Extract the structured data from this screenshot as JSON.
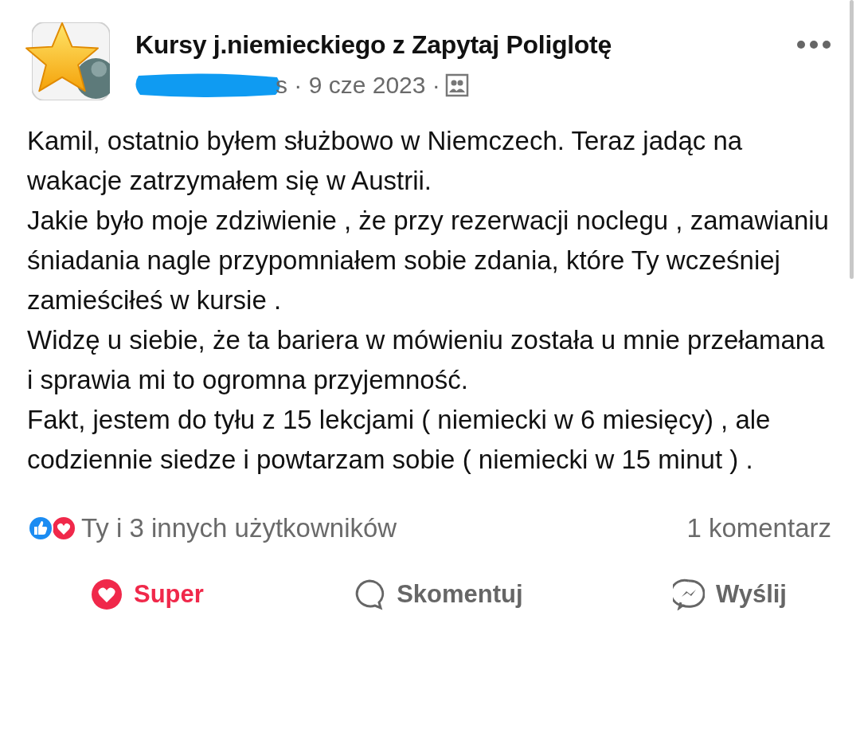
{
  "post": {
    "author": "Kursy j.niemieckiego z Zapytaj Poliglotę",
    "meta": "s · 9 cze 2023 ·",
    "paragraphs": [
      "Kamil,  ostatnio byłem służbowo w Niemczech. Teraz jadąc na wakacje zatrzymałem się w Austrii.",
      "Jakie było moje zdziwienie , że przy rezerwacji noclegu , zamawianiu śniadania nagle przypomniałem sobie zdania, które Ty wcześniej zamieściłeś w kursie .",
      "Widzę u siebie, że ta bariera w mówieniu została u mnie przełamana i sprawia mi to ogromna przyjemność.",
      "Fakt, jestem do tyłu z 15 lekcjami ( niemiecki w 6 miesięcy) , ale codziennie siedze i powtarzam sobie ( niemiecki w 15 minut ) ."
    ],
    "reactions_summary": "Ty i 3 innych użytkowników",
    "comments_count": "1 komentarz"
  },
  "actions": [
    {
      "kind": "reaction",
      "label": "Super",
      "active": true
    },
    {
      "kind": "comment",
      "label": "Skomentuj",
      "active": false
    },
    {
      "kind": "share",
      "label": "Wyślij",
      "active": false
    }
  ]
}
